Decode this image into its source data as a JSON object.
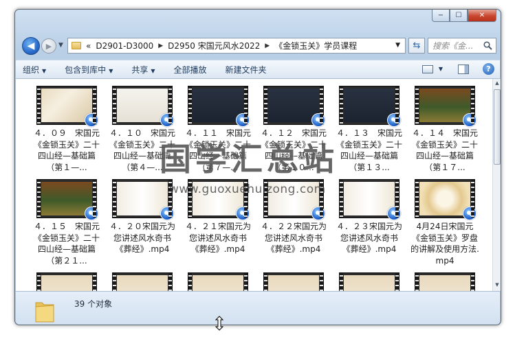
{
  "window": {
    "caption_buttons": {
      "minimize": "−",
      "maximize": "☐",
      "close": "✕"
    }
  },
  "nav": {
    "back_icon": "arrow-left-icon",
    "forward_icon": "arrow-right-icon",
    "breadcrumb_overflow": "«",
    "breadcrumbs": [
      "D2901-D3000",
      "D2950 宋国元风水2022",
      "《金锁玉关》学员课程"
    ],
    "search_placeholder": "搜索《金...",
    "refresh_glyph": "⇆"
  },
  "toolbar": {
    "organize": "组织",
    "include_in_library": "包含到库中",
    "share": "共享",
    "play_all": "全部播放",
    "new_folder": "新建文件夹",
    "help": "?"
  },
  "files": [
    {
      "label": "４．０９　宋国元《金锁玉关》二十四山经—基础篇（第１—...",
      "thumb": "f-a"
    },
    {
      "label": "４．１０　宋国元《金锁玉关》二十四山经—基础篇（第４—...",
      "thumb": "f-b"
    },
    {
      "label": "４．１１　宋国元《金锁玉关》二十四山经—基础篇（第７—...",
      "thumb": "f-c"
    },
    {
      "label": "４．１２　宋国元《金锁玉关》二十四山经—基础篇（第１０...",
      "thumb": "f-c"
    },
    {
      "label": "４．１３　宋国元《金锁玉关》二十四山经—基础篇（第１３...",
      "thumb": "f-c"
    },
    {
      "label": "４．１４　宋国元《金锁玉关》二十四山经—基础篇（第１７...",
      "thumb": "f-d"
    },
    {
      "label": "４．１５　宋国元《金锁玉关》二十四山经—基础篇（第２１...",
      "thumb": "f-d"
    },
    {
      "label": "４．２０宋国元为您讲述风水奇书《葬经》.mp4",
      "thumb": "f-e"
    },
    {
      "label": "４．２１宋国元为您讲述风水奇书《葬经》.mp4",
      "thumb": "f-e"
    },
    {
      "label": "４．２２宋国元为您讲述风水奇书《葬经》.mp4",
      "thumb": "f-e"
    },
    {
      "label": "４．２３宋国元为您讲述风水奇书《葬经》.mp4",
      "thumb": "f-e"
    },
    {
      "label": "4月24日宋国元《金锁玉关》罗盘的讲解及使用方法.mp4",
      "thumb": "f-f"
    },
    {
      "label": "",
      "thumb": "f-g"
    },
    {
      "label": "",
      "thumb": "f-g"
    },
    {
      "label": "",
      "thumb": "f-g"
    },
    {
      "label": "",
      "thumb": "f-g"
    },
    {
      "label": "",
      "thumb": "f-g"
    },
    {
      "label": "",
      "thumb": "f-g"
    }
  ],
  "status": {
    "item_count": "39 个对象"
  },
  "watermark": {
    "title": "国学汇总站",
    "url": "www.guoxuehuizong.com"
  }
}
